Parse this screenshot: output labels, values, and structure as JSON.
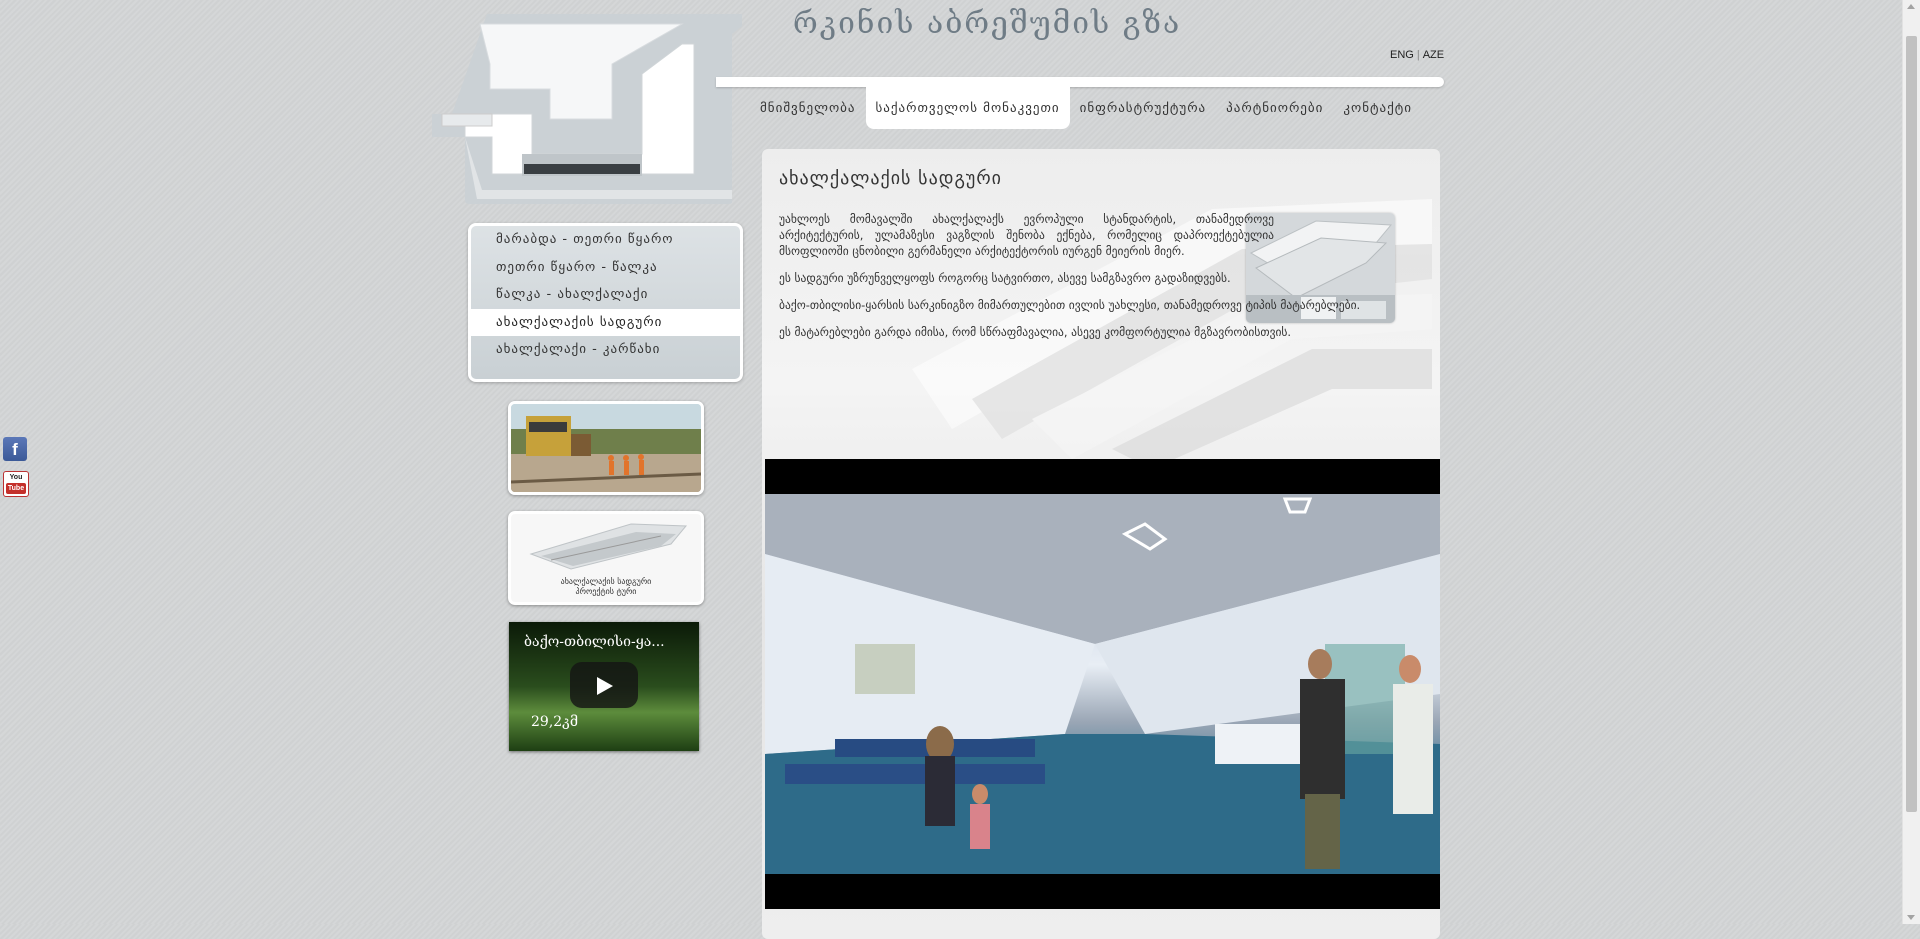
{
  "site_title": "რკინის აბრეშუმის გზა",
  "lang": {
    "eng": "ENG",
    "separator": "|",
    "aze": "AZE"
  },
  "nav": {
    "items": [
      {
        "label": "მნიშვნელობა"
      },
      {
        "label": "საქართველოს მონაკვეთი"
      },
      {
        "label": "ინფრასტრუქტურა"
      },
      {
        "label": "პარტნიორები"
      },
      {
        "label": "კონტაქტი"
      }
    ],
    "active": "საქართველოს მონაკვეთი"
  },
  "sidebar": {
    "items": [
      {
        "label": "მარაბდა - თეთრი წყარო"
      },
      {
        "label": "თეთრი წყარო - წალკა"
      },
      {
        "label": "წალკა - ახალქალაქი"
      },
      {
        "label": "ახალქალაქის სადგური"
      },
      {
        "label": "ახალქალაქი - კარწახი"
      }
    ],
    "active": "ახალქალაქის სადგური"
  },
  "thumbs": {
    "station_caption_line1": "ახალქალაქის სადგური",
    "station_caption_line2": "პროექტის ტური",
    "video_title": "ბაქო-თბილისი-ყა...",
    "video_time": "29,2კმ"
  },
  "main": {
    "title": "ახალქალაქის სადგური",
    "paragraphs": [
      "უახლოეს მომავალში ახალქალაქს ევროპული სტანდარტის, თანამედროვე არქიტექტურის, ულამაზესი ვაგზლის შენობა ექნება, რომელიც დაპროექტებულია მსოფლიოში ცნობილი გერმანელი არქიტექტორის იურგენ მეიერის მიერ.",
      "ეს სადგური უზრუნველყოფს როგორც სატვირთო, ასევე სამგზავრო გადაზიდვებს.",
      "ბაქო-თბილისი-ყარსის სარკინიგზო მიმართულებით ივლის უახლესი, თანამედროვე ტიპის მატარებლები.",
      "ეს მატარებლები გარდა იმისა, რომ სწრაფმავალია, ასევე კომფორტულია მგზავრობისთვის."
    ]
  },
  "social": {
    "facebook": "f",
    "youtube_line1": "You",
    "youtube_line2": "Tube"
  },
  "colors": {
    "background": "#d3d5d6",
    "title": "#6f7c86",
    "panel": "#efefef",
    "facebook": "#3b5998",
    "youtube": "#c4302b"
  }
}
